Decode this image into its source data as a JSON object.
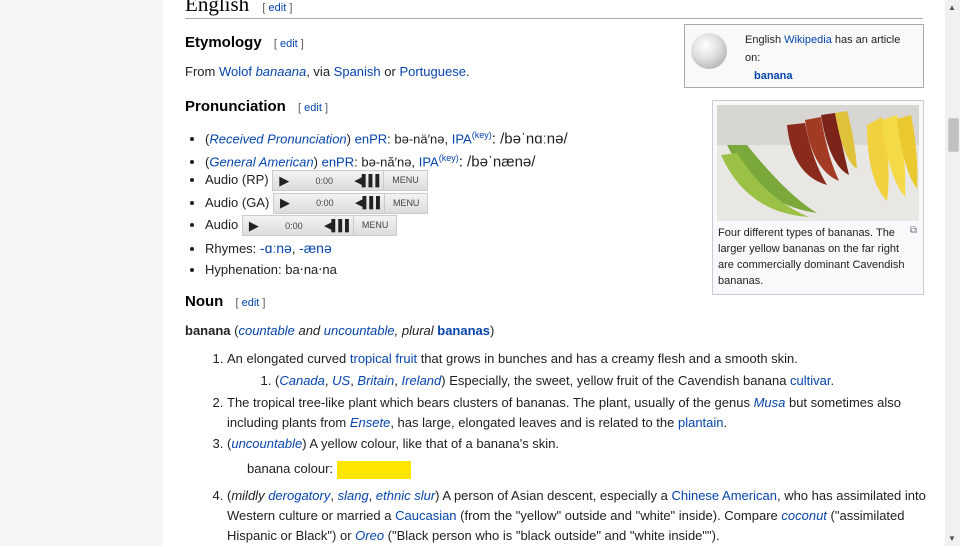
{
  "colors": {
    "link": "#0645ad",
    "banana_swatch": "#ffe600",
    "panel": "#f6f6f6"
  },
  "section": {
    "title": "English",
    "edit": "edit"
  },
  "etymology": {
    "title": "Etymology",
    "edit": "edit",
    "text_from": "From ",
    "wolof": "Wolof",
    "word": "banaana",
    "sep": ", via ",
    "spanish": "Spanish",
    "or": " or ",
    "portuguese": "Portuguese",
    "end": "."
  },
  "wiki_box": {
    "line1a": "English ",
    "wikipedia": "Wikipedia",
    "line1b": " has an article on:",
    "article": "banana",
    "icon": "wikipedia-globe-icon"
  },
  "pronunciation": {
    "title": "Pronunciation",
    "edit": "edit",
    "rp": {
      "open": "(",
      "label": "Received Pronunciation",
      "close": ") ",
      "enpr": "enPR",
      "enpr_val": ": bə-nä′nə, ",
      "ipa": "IPA",
      "key": "(key)",
      "ipa_val": ": /bəˈnɑːnə/"
    },
    "ga": {
      "open": "(",
      "label": "General American",
      "close": ") ",
      "enpr": "enPR",
      "enpr_val": ": bə-nă′nə, ",
      "ipa": "IPA",
      "key": "(key)",
      "ipa_val": ": /bəˈnænə/"
    },
    "audio": [
      {
        "label": "Audio (RP)",
        "time": "0:00",
        "menu": "MENU"
      },
      {
        "label": "Audio (GA)",
        "time": "0:00",
        "menu": "MENU"
      },
      {
        "label": "Audio",
        "time": "0:00",
        "menu": "MENU"
      }
    ],
    "rhymes_label": "Rhymes: ",
    "rhyme1": "-ɑːnə",
    "rhyme_sep": ", ",
    "rhyme2": "-ænə",
    "hyphenation": "Hyphenation: ba‧na‧na"
  },
  "thumb": {
    "caption": "Four different types of bananas. The larger yellow bananas on the far right are commercially dominant Cavendish bananas."
  },
  "noun": {
    "title": "Noun",
    "edit": "edit",
    "headword": "banana",
    "open": " (",
    "countable": "countable",
    "and": " and ",
    "uncountable": "uncountable",
    "plural": ", plural ",
    "plural_word": "bananas",
    "close": ")"
  },
  "senses": {
    "s1a": "An elongated curved ",
    "s1_link": "tropical fruit",
    "s1b": " that grows in bunches and has a creamy flesh and a smooth skin.",
    "s1_1_open": "(",
    "canada": "Canada",
    "us": "US",
    "britain": "Britain",
    "ireland": "Ireland",
    "comma": ", ",
    "s1_1_close": ") Especially, the sweet, yellow fruit of the Cavendish banana ",
    "cultivar": "cultivar",
    "period": ".",
    "s2a": "The tropical tree-like plant which bears clusters of bananas. The plant, usually of the genus ",
    "musa": "Musa",
    "s2b": " but sometimes also including plants from ",
    "ensete": "Ensete",
    "s2c": ", has large, elongated leaves and is related to the ",
    "plantain": "plantain",
    "s3_open": "(",
    "s3_tag": "uncountable",
    "s3": ") A yellow colour, like that of a banana's skin.",
    "colour_label": "banana colour:",
    "s4_open": "(",
    "mildly": "mildly",
    "derogatory": "derogatory",
    "slang": "slang",
    "ethnic_slur": "ethnic slur",
    "s4a": ") A person of Asian descent, especially a ",
    "chinese_american": "Chinese American",
    "s4b": ", who has assimilated into Western culture or married a ",
    "caucasian": "Caucasian",
    "s4c": " (from the \"yellow\" outside and \"white\" inside). Compare ",
    "coconut": "coconut",
    "s4d": " (\"assimilated Hispanic or Black\") or ",
    "oreo": "Oreo",
    "s4e": " (\"Black person who is \"black outside\" and \"white inside\"\")."
  }
}
